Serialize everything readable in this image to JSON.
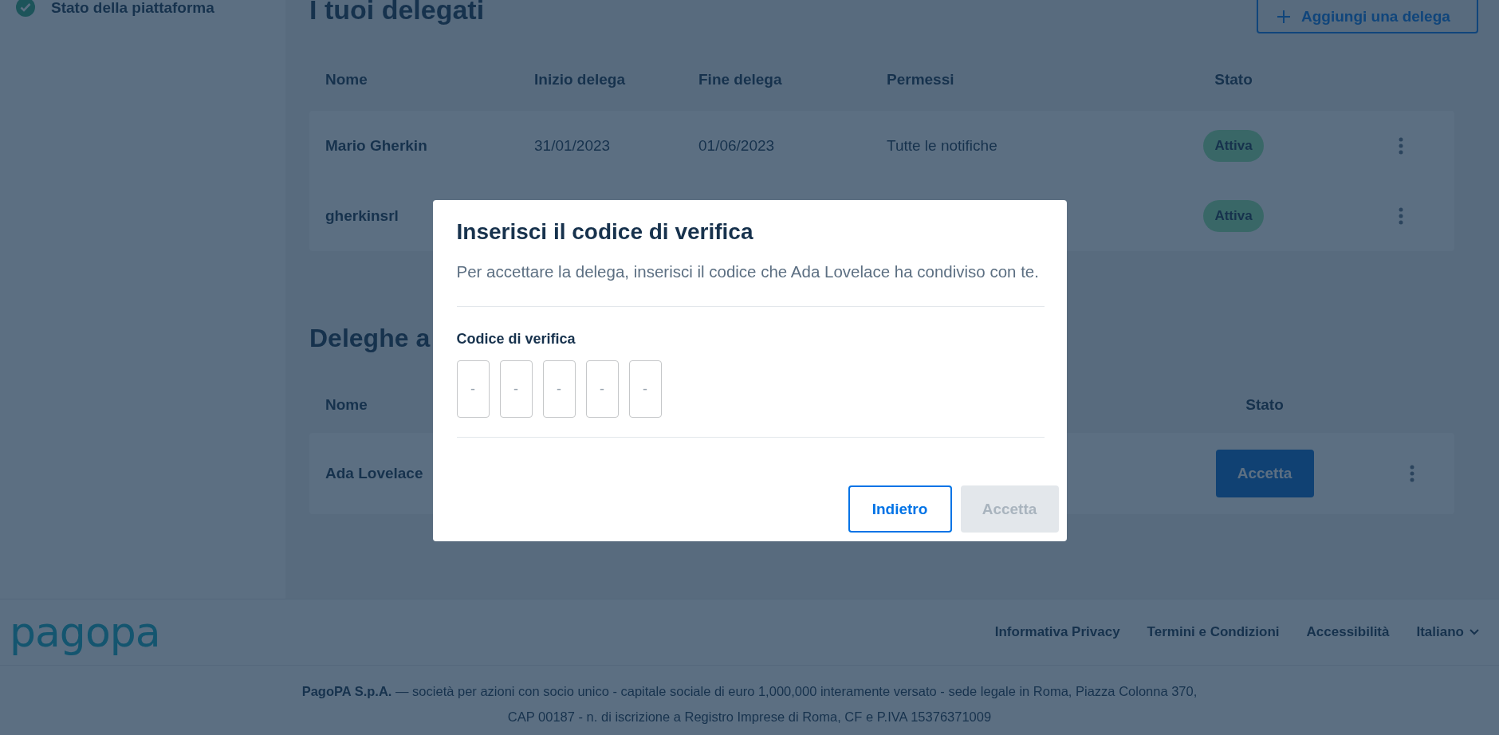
{
  "sidebar": {
    "items": [
      {
        "label": "Stato della piattaforma"
      }
    ]
  },
  "delegates": {
    "title": "I tuoi delegati",
    "add_button": "Aggiungi una delega",
    "columns": [
      "Nome",
      "Inizio delega",
      "Fine delega",
      "Permessi",
      "Stato"
    ],
    "rows": [
      {
        "name": "Mario Gherkin",
        "start": "31/01/2023",
        "end": "01/06/2023",
        "permissions": "Tutte le notifiche",
        "status": "Attiva"
      },
      {
        "name": "gherkinsrl",
        "status": "Attiva"
      }
    ]
  },
  "delegators": {
    "title": "Deleghe a",
    "columns": [
      "Nome",
      "Stato"
    ],
    "rows": [
      {
        "name": "Ada Lovelace",
        "action": "Accetta"
      }
    ]
  },
  "dialog": {
    "title": "Inserisci il codice di verifica",
    "description": "Per accettare la delega, inserisci il codice che Ada Lovelace ha condiviso con te.",
    "field_label": "Codice di verifica",
    "code_fields": [
      {
        "placeholder": "-"
      },
      {
        "placeholder": "-"
      },
      {
        "placeholder": "-"
      },
      {
        "placeholder": "-"
      },
      {
        "placeholder": "-"
      }
    ],
    "buttons": [
      {
        "label": "Indietro",
        "kind": "outlined",
        "disabled": false
      },
      {
        "label": "Accetta",
        "kind": "contained",
        "disabled": true
      }
    ]
  },
  "footer": {
    "logo": "pagopa",
    "links": [
      "Informativa Privacy",
      "Termini e Condizioni",
      "Accessibilità"
    ],
    "language": "Italiano",
    "legal": "**PagoPA S.p.A.** — società per azioni con socio unico - capitale sociale di euro 1,000,000 interamente versato - sede legale in Roma, Piazza Colonna 370, CAP 00187 - n. di iscrizione a Registro Imprese di Roma, CF e P.IVA 15376371009"
  }
}
